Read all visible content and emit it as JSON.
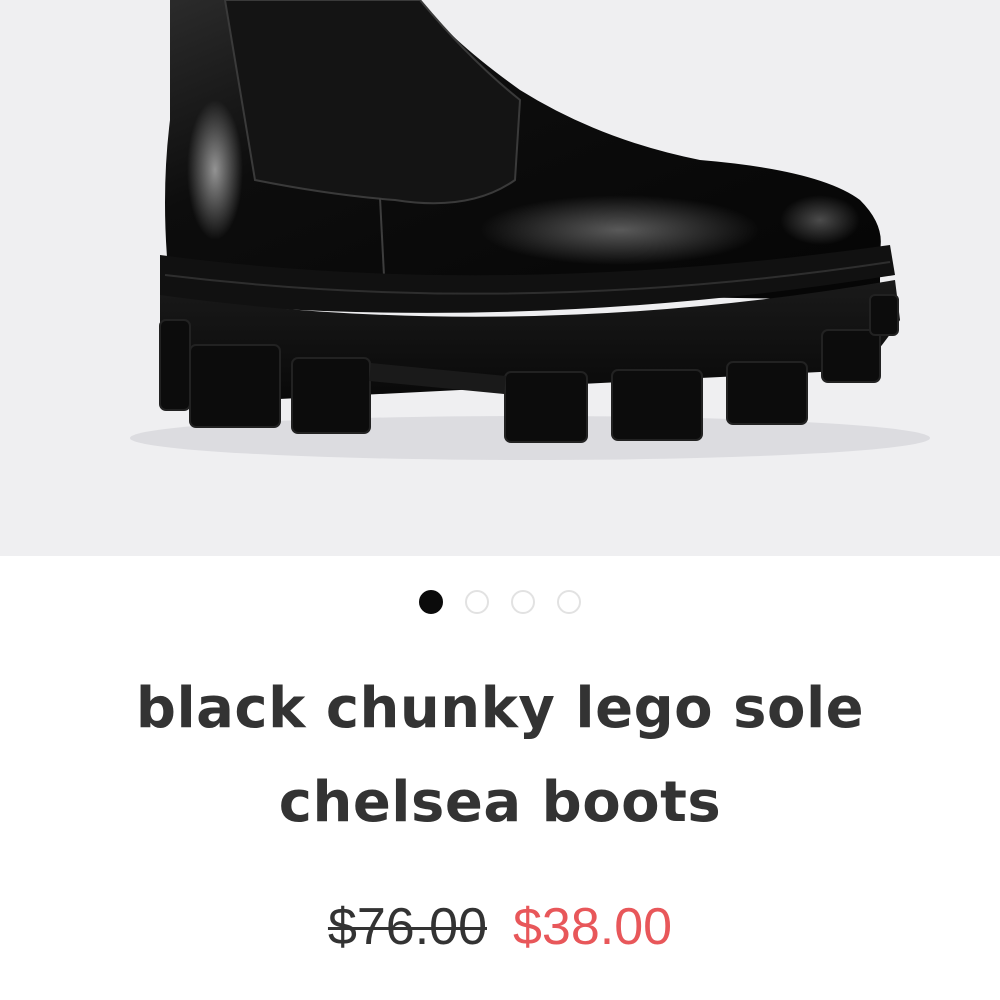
{
  "product": {
    "image_icon": "boot-product-image",
    "title": "black chunky lego sole chelsea boots",
    "original_price": "$76.00",
    "sale_price": "$38.00"
  },
  "carousel": {
    "slide_count": 4,
    "active_index": 0
  },
  "colors": {
    "image_background": "#efeff1",
    "title_text": "#333333",
    "sale_price": "#e8575a",
    "dot_active": "#0b0b0b",
    "dot_inactive_border": "#e2e2e2"
  }
}
